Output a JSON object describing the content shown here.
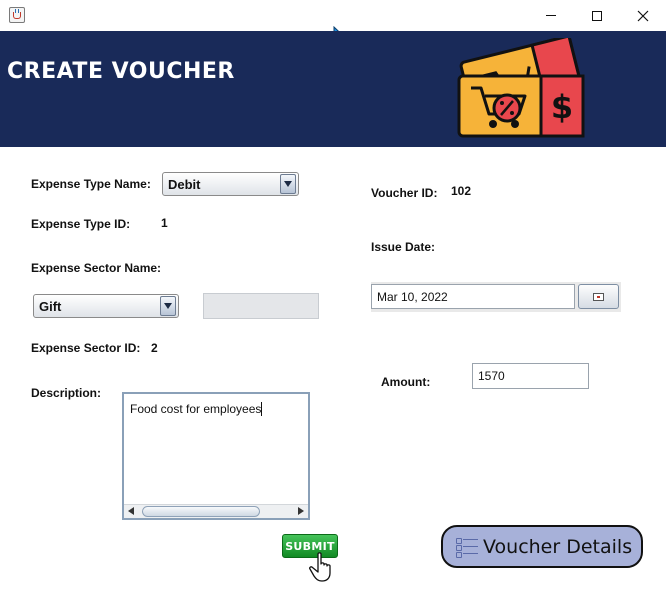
{
  "window": {
    "icon": "java-cup-icon",
    "controls": [
      "minimize-icon",
      "maximize-icon",
      "close-icon"
    ]
  },
  "header": {
    "title": "CREATE VOUCHER",
    "graphic": "voucher-coupon-graphic",
    "colors": {
      "background": "#192a59",
      "ticket_yellow": "#f6b339",
      "ticket_red": "#e8474d"
    }
  },
  "form": {
    "expense_type_name_label": "Expense Type Name:",
    "expense_type_name_value": "Debit",
    "expense_type_id_label": "Expense Type ID:",
    "expense_type_id_value": "1",
    "expense_sector_name_label": "Expense Sector Name:",
    "expense_sector_name_value": "Gift",
    "expense_sector_id_label": "Expense Sector ID:",
    "expense_sector_id_value": "2",
    "description_label": "Description:",
    "description_value": "Food cost for employees",
    "voucher_id_label": "Voucher ID:",
    "voucher_id_value": "102",
    "issue_date_label": "Issue Date:",
    "issue_date_value": "Mar 10, 2022",
    "amount_label": "Amount:",
    "amount_value": "1570"
  },
  "buttons": {
    "submit_label": "SUBMIT",
    "submit_color": "#1fa33a",
    "voucher_details_label": "Voucher Details",
    "voucher_details_color": "#a7b1d9"
  }
}
